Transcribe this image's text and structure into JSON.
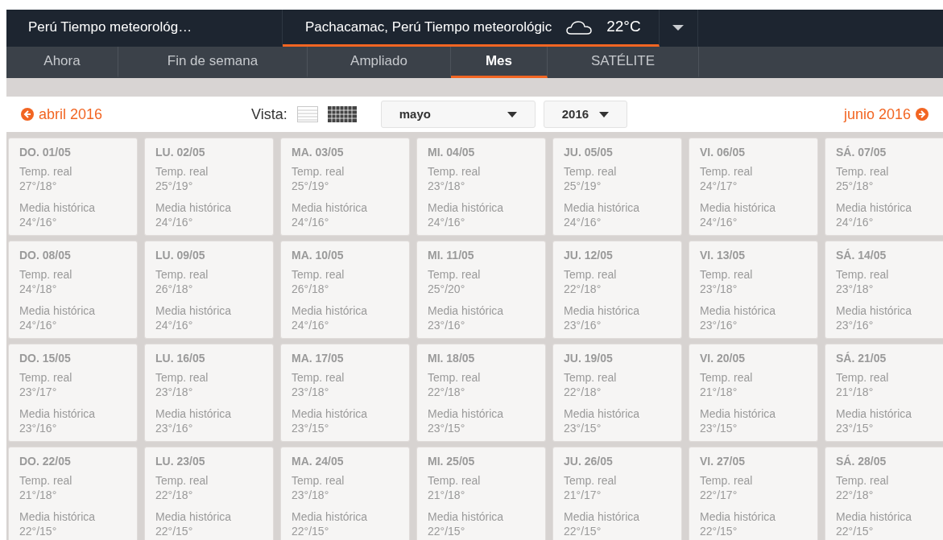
{
  "location_tabs": [
    {
      "label": "Perú Tiempo meteorológ…",
      "selected": false
    },
    {
      "label": "Pachacamac, Perú Tiempo meteorológic",
      "selected": true,
      "temperature": "22°C"
    }
  ],
  "nav_tabs": [
    {
      "label": "Ahora",
      "selected": false
    },
    {
      "label": "Fin de semana",
      "selected": false
    },
    {
      "label": "Ampliado",
      "selected": false
    },
    {
      "label": "Mes",
      "selected": true
    },
    {
      "label": "SATÉLITE",
      "selected": false
    }
  ],
  "toolbar": {
    "previous": "abril 2016",
    "view_label": "Vista:",
    "views": [
      {
        "kind": "list",
        "selected": false
      },
      {
        "kind": "grid",
        "selected": true
      }
    ],
    "month": "mayo",
    "year": "2016",
    "next": "junio 2016"
  },
  "weeks": [
    [
      {
        "day": "DO. 01/05",
        "real_label": "Temp. real",
        "real": "27°/18°",
        "avg_label": "Media histórica",
        "avg": "24°/16°"
      },
      {
        "day": "LU. 02/05",
        "real_label": "Temp. real",
        "real": "25°/19°",
        "avg_label": "Media histórica",
        "avg": "24°/16°"
      },
      {
        "day": "MA. 03/05",
        "real_label": "Temp. real",
        "real": "25°/19°",
        "avg_label": "Media histórica",
        "avg": "24°/16°"
      },
      {
        "day": "MI. 04/05",
        "real_label": "Temp. real",
        "real": "23°/18°",
        "avg_label": "Media histórica",
        "avg": "24°/16°"
      },
      {
        "day": "JU. 05/05",
        "real_label": "Temp. real",
        "real": "25°/19°",
        "avg_label": "Media histórica",
        "avg": "24°/16°"
      },
      {
        "day": "VI. 06/05",
        "real_label": "Temp. real",
        "real": "24°/17°",
        "avg_label": "Media histórica",
        "avg": "24°/16°"
      },
      {
        "day": "SÁ. 07/05",
        "real_label": "Temp. real",
        "real": "25°/18°",
        "avg_label": "Media histórica",
        "avg": "24°/16°"
      }
    ],
    [
      {
        "day": "DO. 08/05",
        "real_label": "Temp. real",
        "real": "24°/18°",
        "avg_label": "Media histórica",
        "avg": "24°/16°"
      },
      {
        "day": "LU. 09/05",
        "real_label": "Temp. real",
        "real": "26°/18°",
        "avg_label": "Media histórica",
        "avg": "24°/16°"
      },
      {
        "day": "MA. 10/05",
        "real_label": "Temp. real",
        "real": "26°/18°",
        "avg_label": "Media histórica",
        "avg": "24°/16°"
      },
      {
        "day": "MI. 11/05",
        "real_label": "Temp. real",
        "real": "25°/20°",
        "avg_label": "Media histórica",
        "avg": "23°/16°"
      },
      {
        "day": "JU. 12/05",
        "real_label": "Temp. real",
        "real": "22°/18°",
        "avg_label": "Media histórica",
        "avg": "23°/16°"
      },
      {
        "day": "VI. 13/05",
        "real_label": "Temp. real",
        "real": "23°/18°",
        "avg_label": "Media histórica",
        "avg": "23°/16°"
      },
      {
        "day": "SÁ. 14/05",
        "real_label": "Temp. real",
        "real": "23°/18°",
        "avg_label": "Media histórica",
        "avg": "23°/16°"
      }
    ],
    [
      {
        "day": "DO. 15/05",
        "real_label": "Temp. real",
        "real": "23°/17°",
        "avg_label": "Media histórica",
        "avg": "23°/16°"
      },
      {
        "day": "LU. 16/05",
        "real_label": "Temp. real",
        "real": "23°/18°",
        "avg_label": "Media histórica",
        "avg": "23°/16°"
      },
      {
        "day": "MA. 17/05",
        "real_label": "Temp. real",
        "real": "23°/18°",
        "avg_label": "Media histórica",
        "avg": "23°/15°"
      },
      {
        "day": "MI. 18/05",
        "real_label": "Temp. real",
        "real": "22°/18°",
        "avg_label": "Media histórica",
        "avg": "23°/15°"
      },
      {
        "day": "JU. 19/05",
        "real_label": "Temp. real",
        "real": "22°/18°",
        "avg_label": "Media histórica",
        "avg": "23°/15°"
      },
      {
        "day": "VI. 20/05",
        "real_label": "Temp. real",
        "real": "21°/18°",
        "avg_label": "Media histórica",
        "avg": "23°/15°"
      },
      {
        "day": "SÁ. 21/05",
        "real_label": "Temp. real",
        "real": "21°/18°",
        "avg_label": "Media histórica",
        "avg": "23°/15°"
      }
    ],
    [
      {
        "day": "DO. 22/05",
        "real_label": "Temp. real",
        "real": "21°/18°",
        "avg_label": "Media histórica",
        "avg": "22°/15°"
      },
      {
        "day": "LU. 23/05",
        "real_label": "Temp. real",
        "real": "22°/18°",
        "avg_label": "Media histórica",
        "avg": "22°/15°"
      },
      {
        "day": "MA. 24/05",
        "real_label": "Temp. real",
        "real": "23°/18°",
        "avg_label": "Media histórica",
        "avg": "22°/15°"
      },
      {
        "day": "MI. 25/05",
        "real_label": "Temp. real",
        "real": "21°/18°",
        "avg_label": "Media histórica",
        "avg": "22°/15°"
      },
      {
        "day": "JU. 26/05",
        "real_label": "Temp. real",
        "real": "21°/17°",
        "avg_label": "Media histórica",
        "avg": "22°/15°"
      },
      {
        "day": "VI. 27/05",
        "real_label": "Temp. real",
        "real": "22°/17°",
        "avg_label": "Media histórica",
        "avg": "22°/15°"
      },
      {
        "day": "SÁ. 28/05",
        "real_label": "Temp. real",
        "real": "22°/18°",
        "avg_label": "Media histórica",
        "avg": "22°/15°"
      }
    ]
  ]
}
